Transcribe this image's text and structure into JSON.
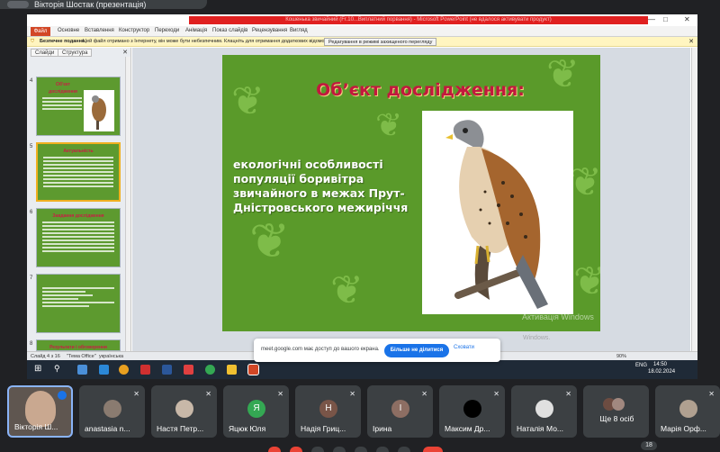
{
  "meet": {
    "presenter_label": "Вікторія Шостак (презентація)",
    "share_banner": {
      "text": "meet.google.com має доступ до вашого екрана.",
      "stop_label": "Більше не ділитися",
      "hide_label": "Сховати"
    },
    "participants": [
      {
        "name": "Вікторія Ш...",
        "initial": "",
        "color": "#7a6a60",
        "speaking": true
      },
      {
        "name": "anastasia n...",
        "initial": "",
        "color": "#8a7b70"
      },
      {
        "name": "Настя Петр...",
        "initial": "",
        "color": "#c8b8a8"
      },
      {
        "name": "Яцюк Юля",
        "initial": "Я",
        "color": "#34a853"
      },
      {
        "name": "Надія Гриц...",
        "initial": "Н",
        "color": "#795548"
      },
      {
        "name": "Ірина",
        "initial": "І",
        "color": "#8d6e63"
      },
      {
        "name": "Максим Др...",
        "initial": "",
        "color": "#000000"
      },
      {
        "name": "Наталія Мо...",
        "initial": "",
        "color": "#e0e0e0"
      },
      {
        "name": "Ще 8 осіб",
        "initial": "",
        "color": "#6d4c41"
      },
      {
        "name": "Марія Орф...",
        "initial": "",
        "color": "#b0a090"
      }
    ],
    "participant_count": "18"
  },
  "powerpoint": {
    "title": "Кошенька звичайний (Fr.10...Виплатний порвання) - Microsoft PowerPoint (не вдалося активувати продукт)",
    "ribbon_tabs": [
      "Файл",
      "Основне",
      "Вставлення",
      "Конструктор",
      "Переходи",
      "Анімація",
      "Показ слайдів",
      "Рецензування",
      "Вигляд"
    ],
    "security_bar": {
      "label": "Безпечне подання",
      "message": "Цей файл отримано з Інтернету, він може бути небезпечним. Клацніть для отримання додаткових відомостей.",
      "button": "Редагування в режимі захищеного перегляду"
    },
    "panel_tabs": [
      "Слайди",
      "Структура"
    ],
    "thumbnails": [
      {
        "num": "4",
        "title": "Об'єкт дослідження"
      },
      {
        "num": "5",
        "title": "Актуальність"
      },
      {
        "num": "6",
        "title": "Завдання дослідження"
      },
      {
        "num": "7",
        "title": ""
      },
      {
        "num": "8",
        "title": "Результати і обговорення"
      }
    ],
    "slide": {
      "title": "Об’єкт дослідження:",
      "body": " екологічні особливості популяції боривітра звичайного в межах Прут-Дністровського межиріччя"
    },
    "activation_watermark": "Активація Windows",
    "windows_watermark": "Windows.",
    "statusbar": {
      "slide_info": "Слайд 4 з 16",
      "theme": "\"Тема Office\"",
      "language": "українська",
      "zoom": "90%"
    },
    "taskbar": {
      "time": "14:50",
      "date": "18.02.2024",
      "lang": "ENG"
    }
  }
}
